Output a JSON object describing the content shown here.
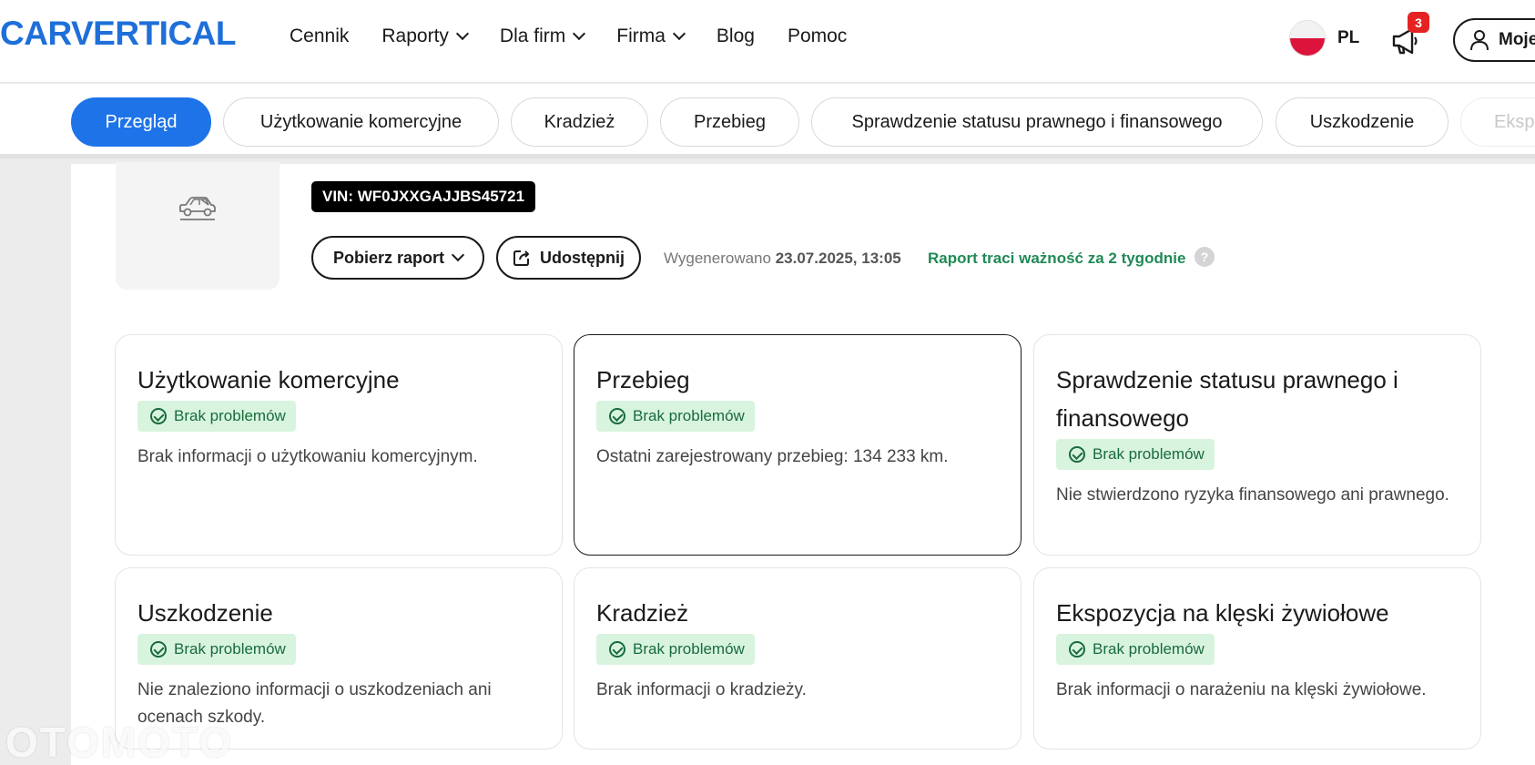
{
  "header": {
    "logo": "CARVERTICAL",
    "nav": [
      {
        "label": "Cennik",
        "dropdown": false
      },
      {
        "label": "Raporty",
        "dropdown": true
      },
      {
        "label": "Dla firm",
        "dropdown": true
      },
      {
        "label": "Firma",
        "dropdown": true
      },
      {
        "label": "Blog",
        "dropdown": false
      },
      {
        "label": "Pomoc",
        "dropdown": false
      }
    ],
    "language": "PL",
    "notifications_count": "3",
    "account_label": "Moje"
  },
  "tabs": [
    {
      "label": "Przegląd",
      "active": true
    },
    {
      "label": "Użytkowanie komercyjne"
    },
    {
      "label": "Kradzież"
    },
    {
      "label": "Przebieg"
    },
    {
      "label": "Sprawdzenie statusu prawnego i finansowego"
    },
    {
      "label": "Uszkodzenie"
    },
    {
      "label": "Ekspo"
    }
  ],
  "report": {
    "vin": "VIN: WF0JXXGAJJBS45721",
    "download_label": "Pobierz raport",
    "share_label": "Udostępnij",
    "generated_prefix": "Wygenerowano",
    "generated_date": "23.07.2025, 13:05",
    "expiry_text": "Raport traci ważność za 2 tygodnie",
    "help_glyph": "?"
  },
  "cards": [
    {
      "title": "Użytkowanie komercyjne",
      "badge": "Brak problemów",
      "desc": "Brak informacji o użytkowaniu komercyjnym."
    },
    {
      "title": "Przebieg",
      "badge": "Brak problemów",
      "desc": "Ostatni zarejestrowany przebieg: 134 233 km."
    },
    {
      "title": "Sprawdzenie statusu prawnego i finansowego",
      "badge": "Brak problemów",
      "desc": "Nie stwierdzono ryzyka finansowego ani prawnego."
    },
    {
      "title": "Uszkodzenie",
      "badge": "Brak problemów",
      "desc": "Nie znaleziono informacji o uszkodzeniach ani ocenach szkody."
    },
    {
      "title": "Kradzież",
      "badge": "Brak problemów",
      "desc": "Brak informacji o kradzieży."
    },
    {
      "title": "Ekspozycja na klęski żywiołowe",
      "badge": "Brak problemów",
      "desc": "Brak informacji o narażeniu na klęski żywiołowe."
    }
  ],
  "watermark": "OTOMOTO",
  "colors": {
    "brand_blue": "#1e73e8",
    "ok_green": "#1f8a55",
    "badge_bg": "#d8f4df",
    "alert_red": "#e52222"
  }
}
